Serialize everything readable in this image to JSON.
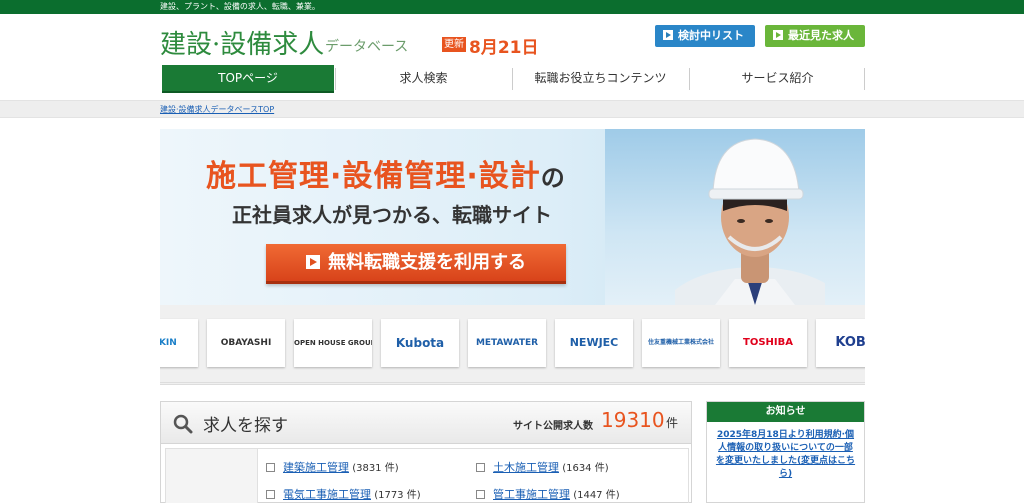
{
  "topbar": {
    "text": "建設、プラント、設備の求人、転職、兼業。"
  },
  "header": {
    "logo_main": "建設·設備求人",
    "logo_sub": "データベース",
    "update_badge": "更新",
    "update_date": "8月21日",
    "btn_review_list": "検討中リスト",
    "btn_recent_jobs": "最近見た求人"
  },
  "nav": {
    "items": [
      {
        "label": "TOPページ"
      },
      {
        "label": "求人検索"
      },
      {
        "label": "転職お役立ちコンテンツ"
      },
      {
        "label": "サービス紹介"
      }
    ]
  },
  "breadcrumb": {
    "text": "建設·設備求人データベースTOP"
  },
  "hero": {
    "headline": "施工管理·設備管理·設計",
    "headline_particle": "の",
    "subline": "正社員求人が見つかる、転職サイト",
    "cta": "無料転職支援を利用する"
  },
  "logos": {
    "items": [
      {
        "name": "DAIKIN",
        "color": "#1a7fc8"
      },
      {
        "name": "OBAYASHI",
        "color": "#333333"
      },
      {
        "name": "OPEN HOUSE GROUP",
        "color": "#333333"
      },
      {
        "name": "Kubota",
        "color": "#1f5fa8"
      },
      {
        "name": "METAWATER",
        "color": "#1f5fa8"
      },
      {
        "name": "NEWJEC",
        "color": "#1f5fa8"
      },
      {
        "name": "住友重機械工業株式会社",
        "color": "#1f5fa8"
      },
      {
        "name": "TOSHIBA",
        "color": "#e0001b"
      },
      {
        "name": "KOBE",
        "color": "#1f3f8f"
      }
    ]
  },
  "search": {
    "title": "求人を探す",
    "count_label": "サイト公開求人数",
    "count_value": "19310",
    "count_unit": "件",
    "jobs": [
      {
        "label": "建築施工管理",
        "count": "(3831 件)"
      },
      {
        "label": "土木施工管理",
        "count": "(1634 件)"
      },
      {
        "label": "電気工事施工管理",
        "count": "(1773 件)"
      },
      {
        "label": "管工事施工管理",
        "count": "(1447 件)"
      }
    ]
  },
  "news": {
    "title": "お知らせ",
    "text": "2025年8月18日より利用規約·個人情報の取り扱いについての一部を変更いたしました(変更点はこちら)"
  },
  "colors": {
    "brand_green": "#1a7a35",
    "accent_orange": "#e8541f",
    "button_blue": "#2a86c8",
    "button_green": "#6ab63a"
  }
}
